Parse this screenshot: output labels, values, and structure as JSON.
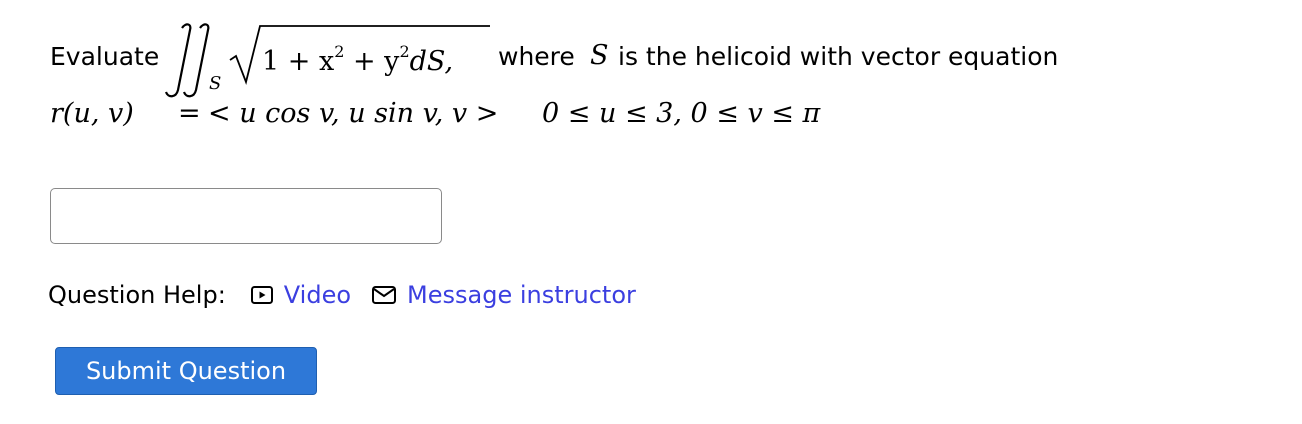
{
  "question": {
    "evaluate_word": "Evaluate",
    "integrand_body": "1 + x",
    "sup_2": "2",
    "plus": " + y",
    "ds": "dS,",
    "subscript": "S",
    "where_text": "where",
    "s_var": "S",
    "rest_text": "is the helicoid with vector equation",
    "line2_lhs": "r(u, v)",
    "line2_eq": "=",
    "line2_vec": "< u cos v, u sin v, v >",
    "line2_bounds": "0 ≤ u ≤ 3,  0 ≤ v ≤ π"
  },
  "answer": {
    "value": "",
    "placeholder": ""
  },
  "help": {
    "label": "Question Help:",
    "video_label": "Video",
    "message_label": "Message instructor"
  },
  "submit": {
    "label": "Submit Question"
  },
  "colors": {
    "link": "#3b3fe0",
    "submit_bg": "#2e78d7"
  },
  "icons": {
    "video": "video-play-icon",
    "message": "envelope-icon"
  }
}
